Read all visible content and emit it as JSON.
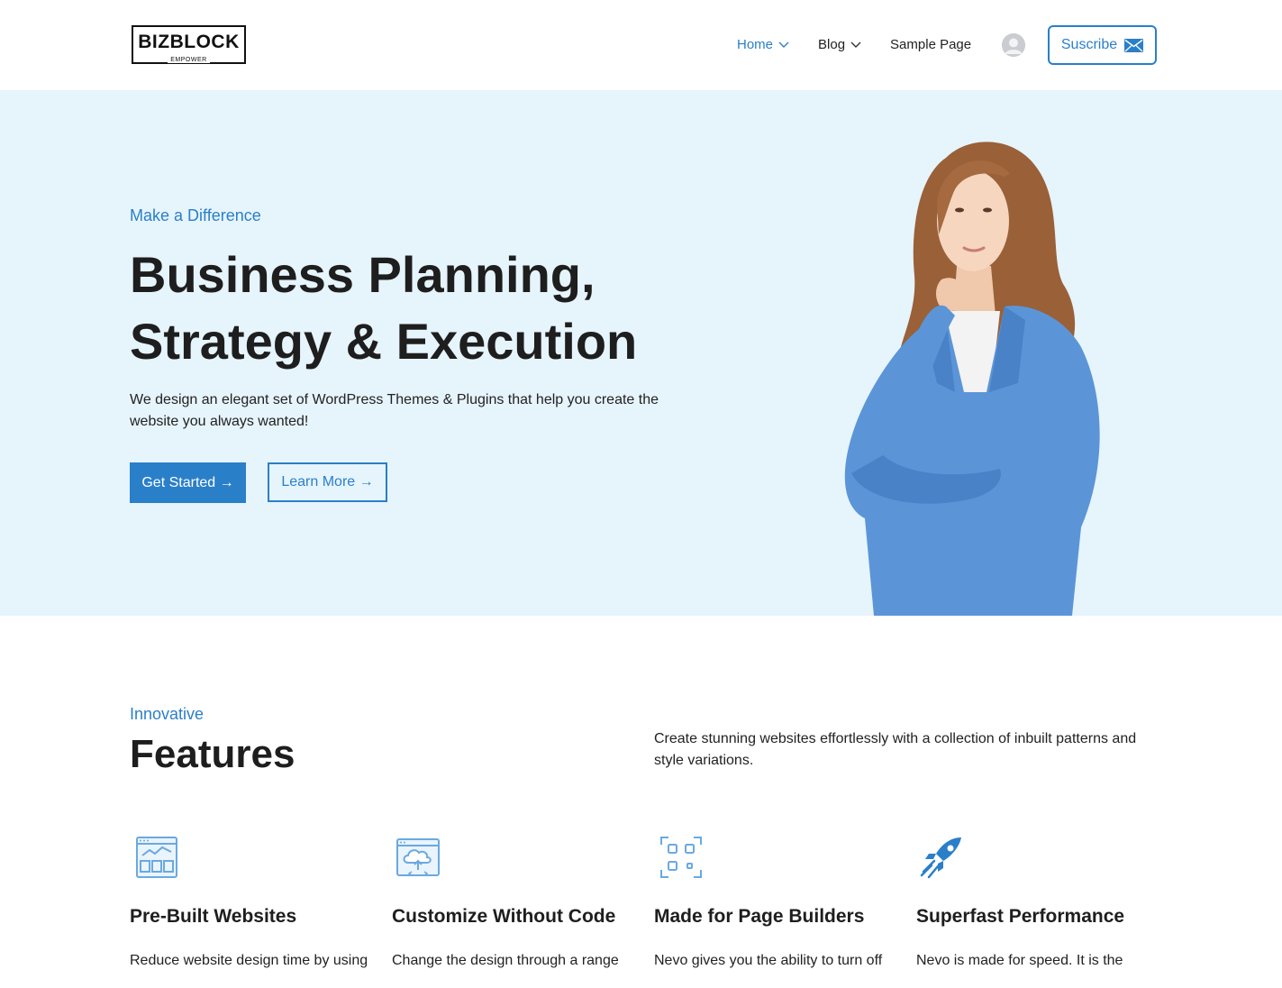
{
  "header": {
    "logo": {
      "brand": "BIZBLOCK",
      "tagline": "EMPOWER"
    },
    "nav": [
      {
        "label": "Home",
        "has_dropdown": true,
        "active": true
      },
      {
        "label": "Blog",
        "has_dropdown": true,
        "active": false
      },
      {
        "label": "Sample Page",
        "has_dropdown": false,
        "active": false
      }
    ],
    "avatar_icon": "user-avatar-icon",
    "subscribe_label": "Suscribe",
    "subscribe_icon": "envelope-icon"
  },
  "hero": {
    "subtitle": "Make a Difference",
    "title_line1": "Business Planning,",
    "title_line2": "Strategy & Execution",
    "description": "We design an elegant set of WordPress Themes & Plugins that help you create the website you always wanted!",
    "primary_button": "Get Started →",
    "secondary_button": "Learn More →"
  },
  "features_section": {
    "subtitle": "Innovative",
    "title": "Features",
    "description": "Create stunning websites effortlessly with a collection of inbuilt patterns and style variations.",
    "items": [
      {
        "icon": "browser-layout-icon",
        "title": "Pre-Built Websites",
        "text": "Reduce website design time by using"
      },
      {
        "icon": "cloud-code-icon",
        "title": "Customize Without Code",
        "text": "Change the design through a range"
      },
      {
        "icon": "grid-focus-icon",
        "title": "Made for Page Builders",
        "text": "Nevo gives you the ability to turn off"
      },
      {
        "icon": "rocket-icon",
        "title": "Superfast Performance",
        "text": "Nevo is made for speed. It is the"
      }
    ]
  },
  "colors": {
    "accent": "#2a7fc9",
    "hero_bg": "#e6f4fc",
    "text": "#1e1e1e"
  }
}
